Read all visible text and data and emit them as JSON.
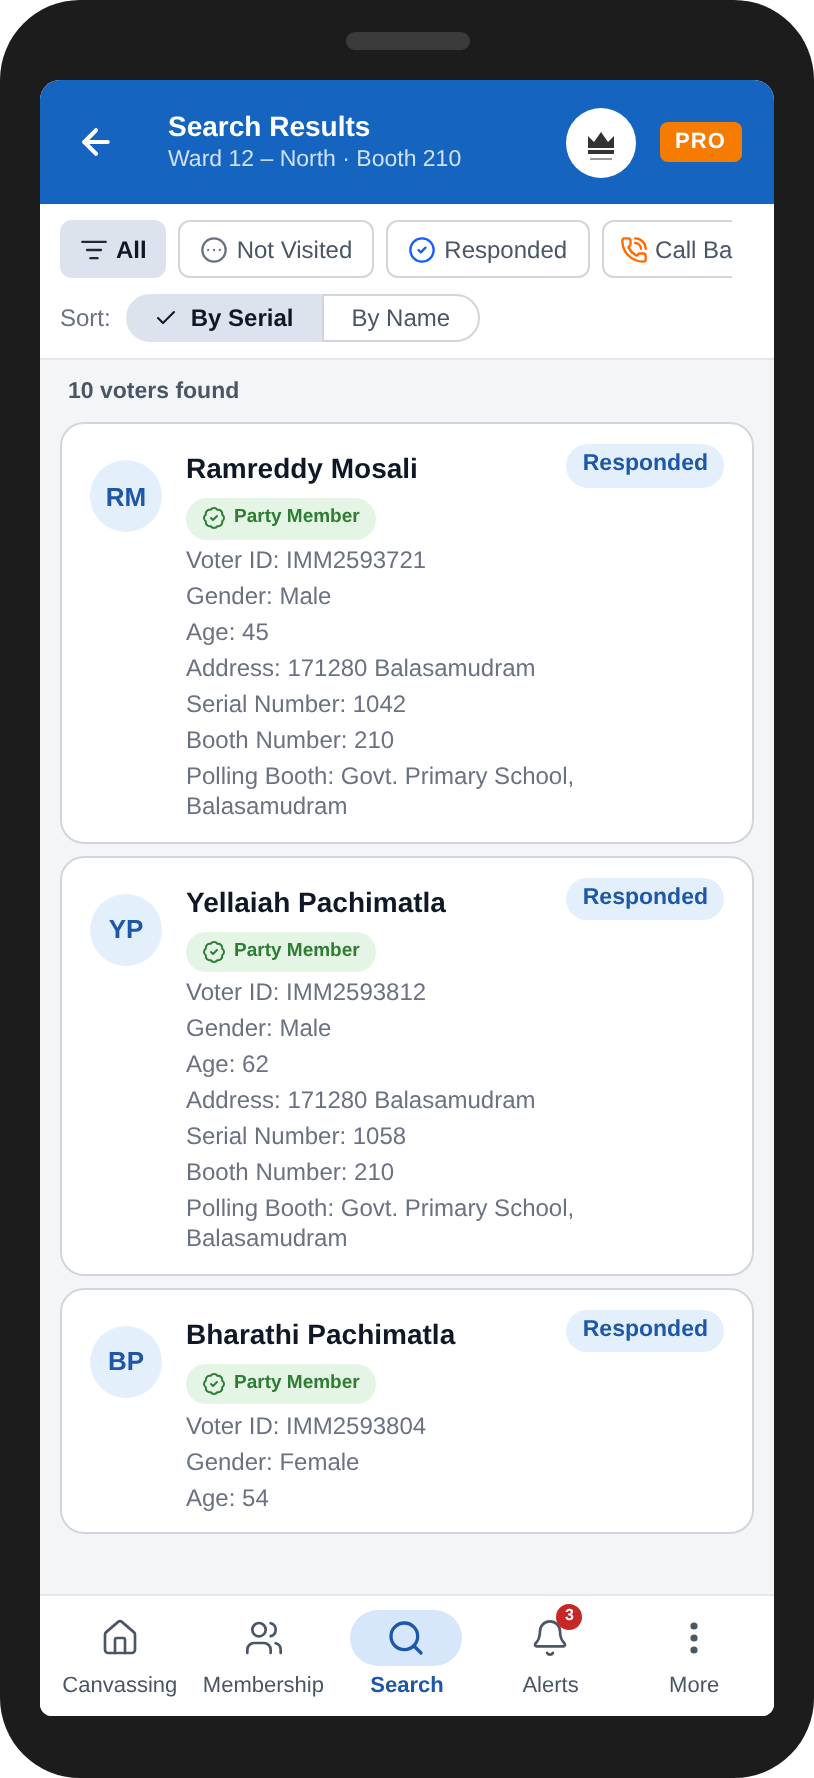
{
  "header": {
    "title": "Search Results",
    "subtitle": "Ward 12 – North · Booth 210",
    "badge": "PRO"
  },
  "filters": [
    {
      "label": "All",
      "kind": "filter",
      "selected": true
    },
    {
      "label": "Not Visited",
      "kind": "dots",
      "selected": false
    },
    {
      "label": "Responded",
      "kind": "check",
      "selected": false
    },
    {
      "label": "Call Ba",
      "kind": "phone",
      "selected": false
    }
  ],
  "sort": {
    "label": "Sort:",
    "options": [
      {
        "label": "By Serial",
        "selected": true
      },
      {
        "label": "By Name",
        "selected": false
      }
    ]
  },
  "count": "10 voters found",
  "voters": [
    {
      "initials": "RM",
      "name": "Ramreddy Mosali",
      "status": "Responded",
      "tag": "Party Member",
      "fields": [
        "Voter ID: IMM2593721",
        "Gender: Male",
        "Age: 45",
        "Address: 171280 Balasamudram",
        "Serial Number: 1042",
        "Booth Number: 210",
        "Polling Booth: Govt. Primary School, Balasamudram"
      ]
    },
    {
      "initials": "YP",
      "name": "Yellaiah Pachimatla",
      "status": "Responded",
      "tag": "Party Member",
      "fields": [
        "Voter ID: IMM2593812",
        "Gender: Male",
        "Age: 62",
        "Address: 171280 Balasamudram",
        "Serial Number: 1058",
        "Booth Number: 210",
        "Polling Booth: Govt. Primary School, Balasamudram"
      ]
    },
    {
      "initials": "BP",
      "name": "Bharathi Pachimatla",
      "status": "Responded",
      "tag": "Party Member",
      "fields": [
        "Voter ID: IMM2593804",
        "Gender: Female",
        "Age: 54"
      ]
    }
  ],
  "nav": [
    {
      "label": "Canvassing",
      "kind": "home",
      "selected": false
    },
    {
      "label": "Membership",
      "kind": "people",
      "selected": false
    },
    {
      "label": "Search",
      "kind": "search",
      "selected": true
    },
    {
      "label": "Alerts",
      "kind": "bell",
      "selected": false,
      "badge": "3"
    },
    {
      "label": "More",
      "kind": "more",
      "selected": false
    }
  ]
}
